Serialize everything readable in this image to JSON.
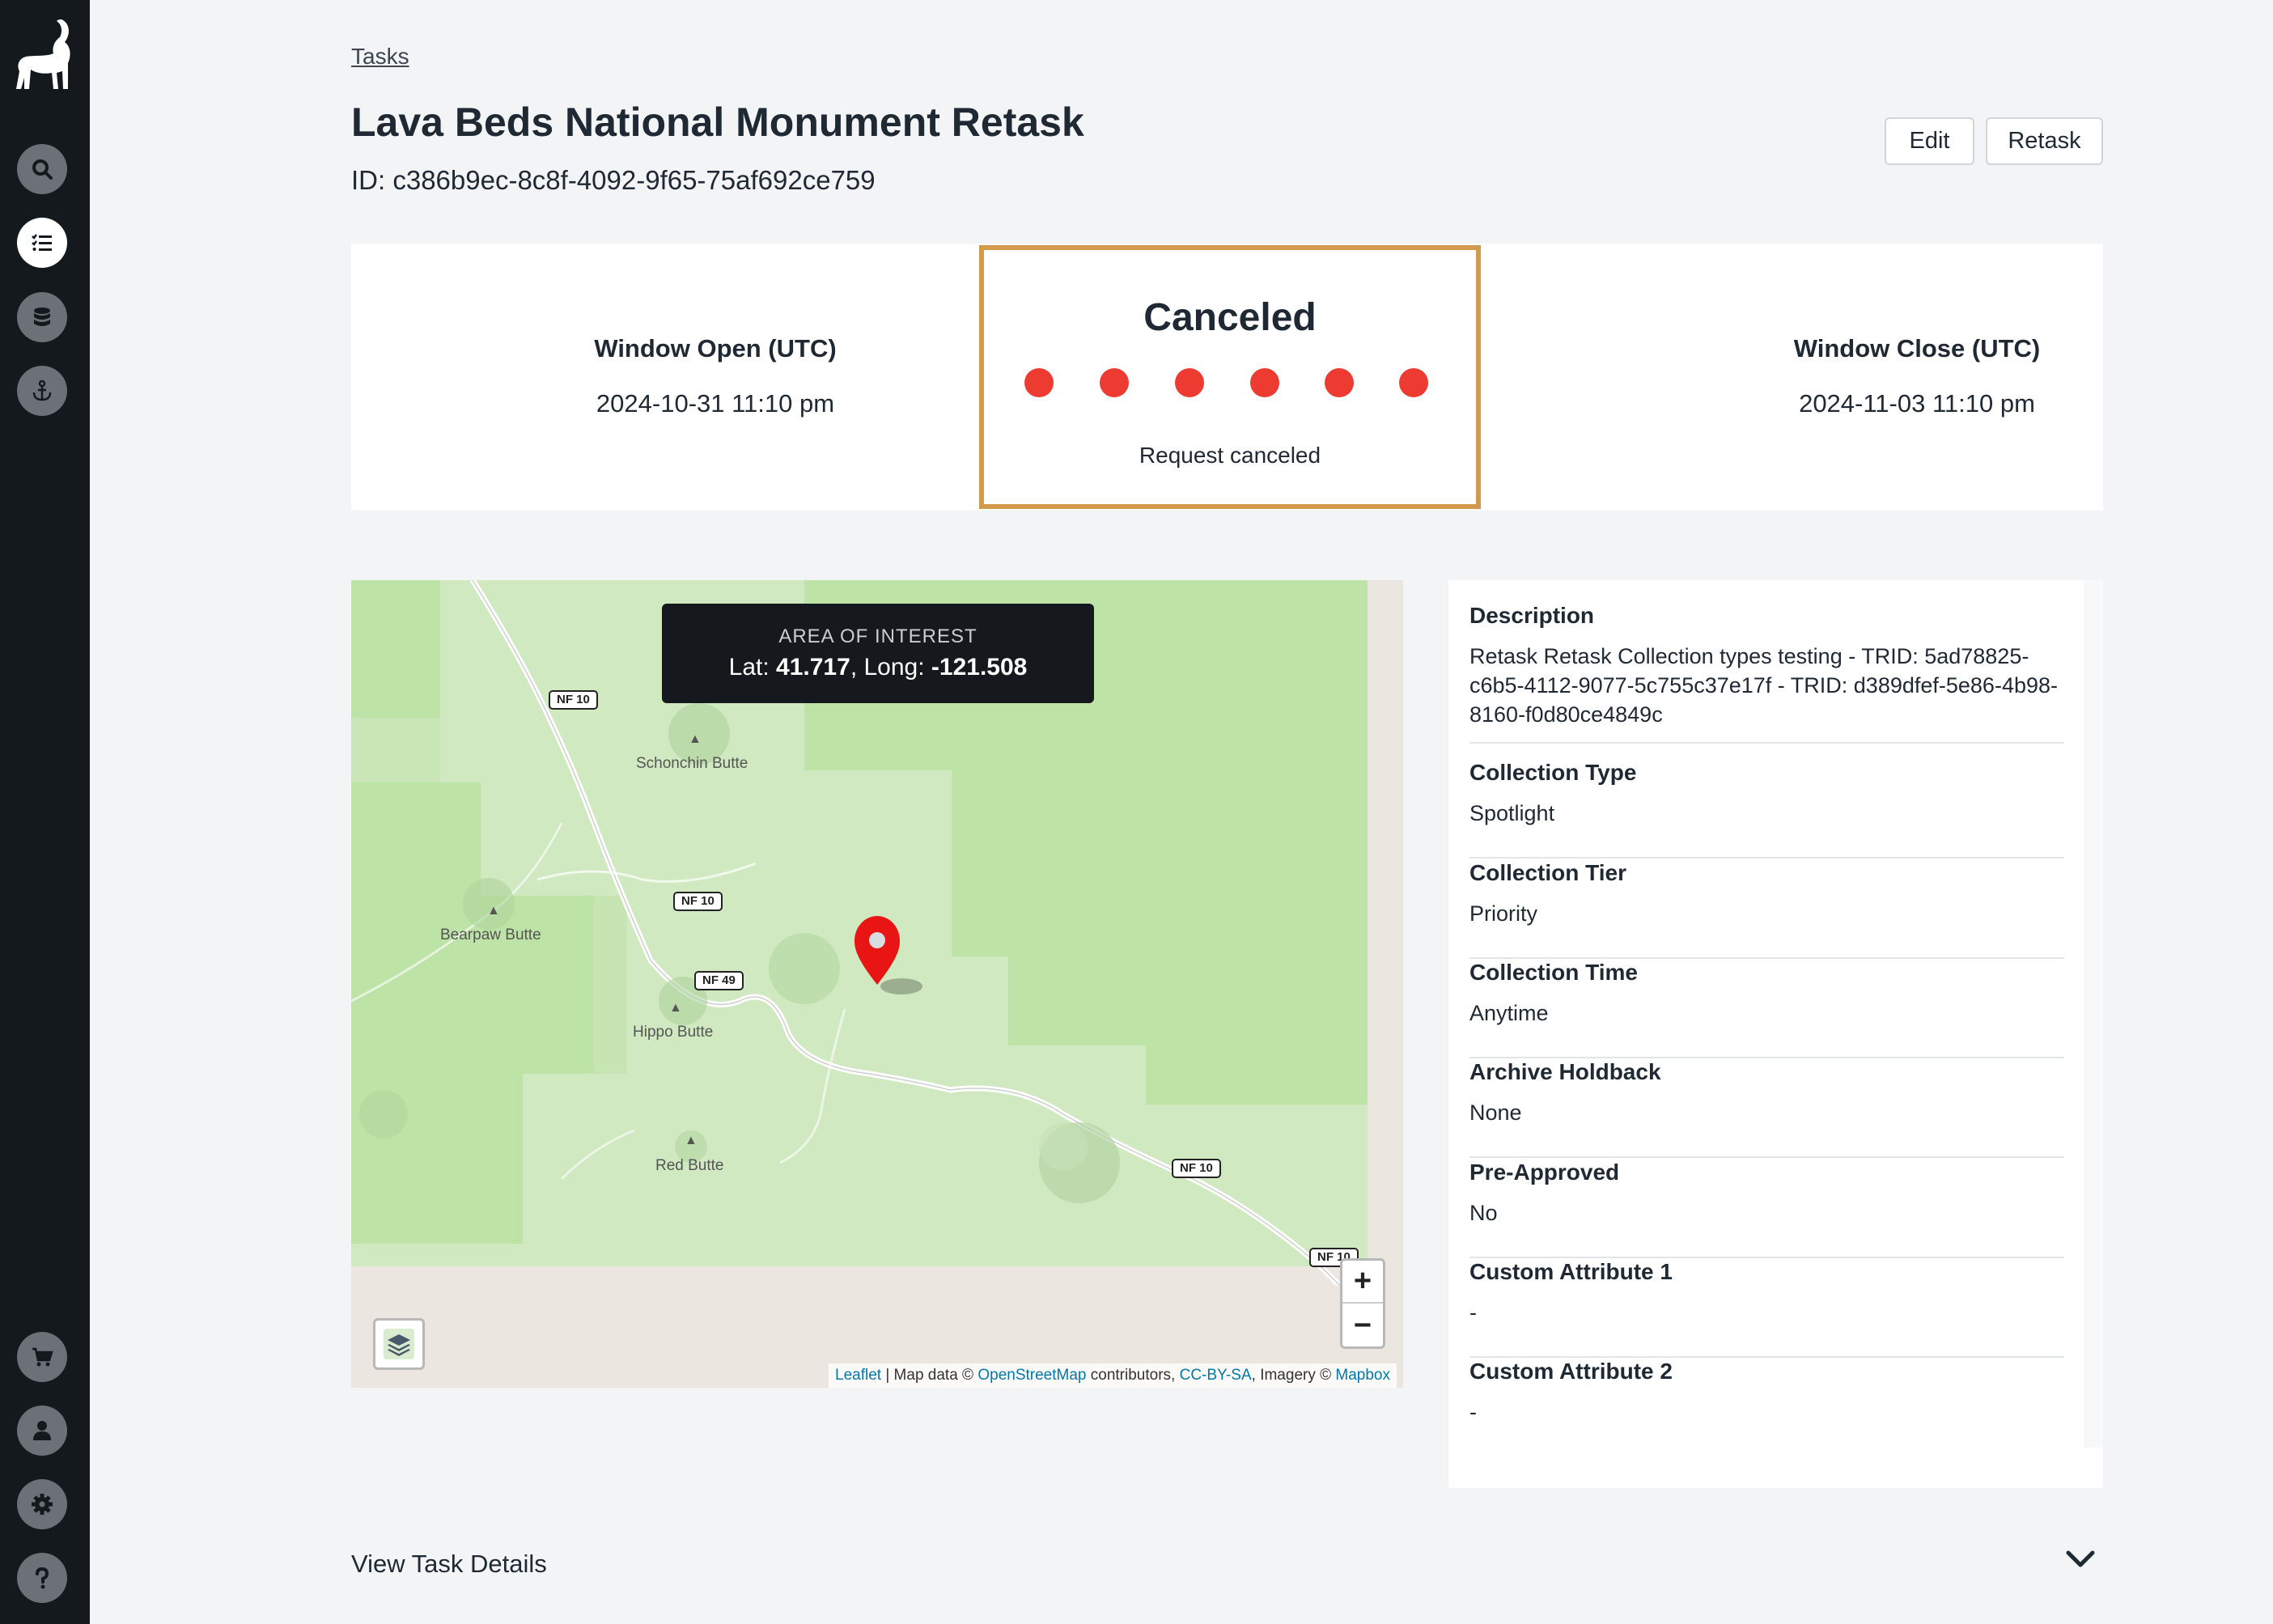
{
  "sidebar": {
    "logo": "ibex-logo-icon",
    "top_items": [
      {
        "name": "search",
        "icon": "search-icon"
      },
      {
        "name": "tasks",
        "icon": "task-list-icon",
        "active": true
      },
      {
        "name": "database",
        "icon": "database-icon"
      },
      {
        "name": "anchor",
        "icon": "anchor-icon"
      }
    ],
    "bottom_items": [
      {
        "name": "cart",
        "icon": "cart-icon"
      },
      {
        "name": "account",
        "icon": "user-icon"
      },
      {
        "name": "settings",
        "icon": "gear-icon"
      },
      {
        "name": "help",
        "icon": "help-icon"
      }
    ]
  },
  "header": {
    "breadcrumb": "Tasks",
    "title": "Lava Beds National Monument Retask",
    "id_line": "ID: c386b9ec-8c8f-4092-9f65-75af692ce759",
    "edit_label": "Edit",
    "retask_label": "Retask"
  },
  "status": {
    "window_open_label": "Window Open (UTC)",
    "window_open_value": "2024-10-31 11:10 pm",
    "state": "Canceled",
    "note": "Request canceled",
    "window_close_label": "Window Close (UTC)",
    "window_close_value": "2024-11-03 11:10 pm",
    "accent_color": "#d19a4c",
    "dot_color": "#ee3b31"
  },
  "map": {
    "aoi_title": "AREA OF INTEREST",
    "lat_label": "Lat:",
    "lat": "41.717",
    "long_label": ", Long:",
    "long": "-121.508",
    "labels": {
      "schonchin": "Schonchin Butte",
      "bearpaw": "Bearpaw Butte",
      "hippo": "Hippo Butte",
      "red": "Red Butte"
    },
    "shields": {
      "a": "NF 10",
      "b": "NF 10",
      "c": "NF 49",
      "d": "NF 10",
      "e": "NF 10"
    },
    "zoom_in": "+",
    "zoom_out": "−",
    "attribution": {
      "leaflet": "Leaflet",
      "sep1": " | Map data © ",
      "osm": "OpenStreetMap",
      "sep2": " contributors, ",
      "license": "CC-BY-SA",
      "sep3": ", Imagery © ",
      "mapbox": "Mapbox"
    }
  },
  "details": [
    {
      "label": "Description",
      "value": "Retask Retask Collection types testing - TRID: 5ad78825-c6b5-4112-9077-5c755c37e17f - TRID: d389dfef-5e86-4b98-8160-f0d80ce4849c"
    },
    {
      "label": "Collection Type",
      "value": "Spotlight"
    },
    {
      "label": "Collection Tier",
      "value": "Priority"
    },
    {
      "label": "Collection Time",
      "value": "Anytime"
    },
    {
      "label": "Archive Holdback",
      "value": "None"
    },
    {
      "label": "Pre-Approved",
      "value": "No"
    },
    {
      "label": "Custom Attribute 1",
      "value": "-"
    },
    {
      "label": "Custom Attribute 2",
      "value": "-"
    }
  ],
  "footer": {
    "view_details": "View Task Details"
  }
}
